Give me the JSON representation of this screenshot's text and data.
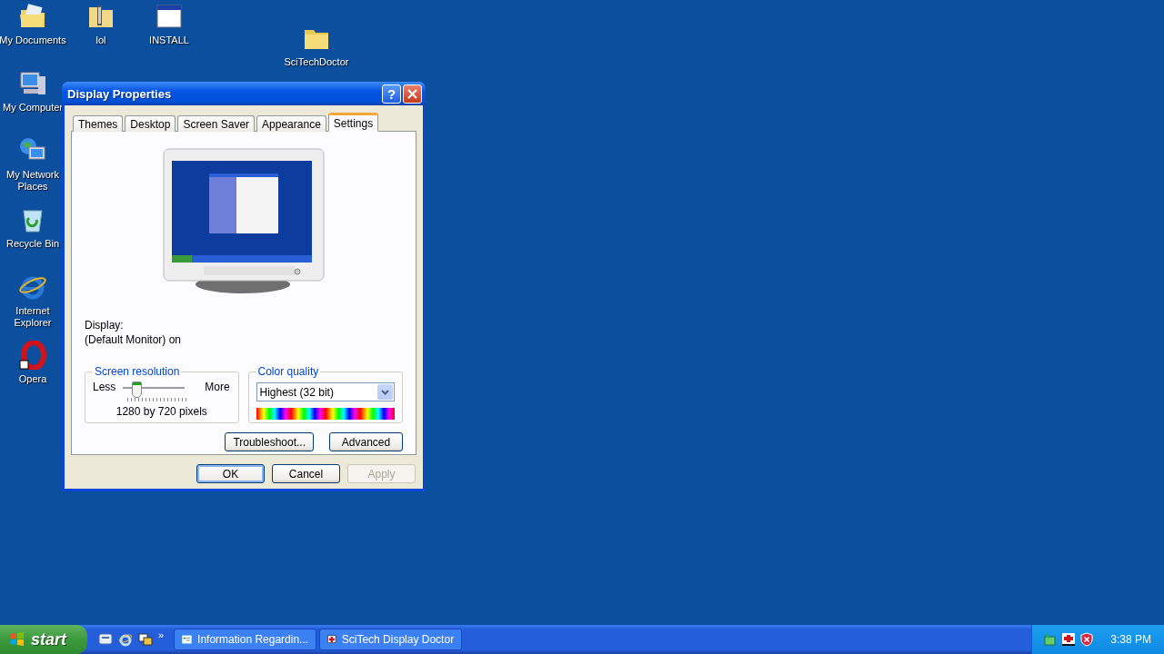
{
  "desktop_icons": [
    {
      "label": "My Documents",
      "kind": "documents"
    },
    {
      "label": "lol",
      "kind": "zip-folder"
    },
    {
      "label": "INSTALL",
      "kind": "window"
    },
    {
      "label": "SciTechDoctor",
      "kind": "folder"
    },
    {
      "label": "My Computer",
      "kind": "computer"
    },
    {
      "label": "My Network Places",
      "kind": "network"
    },
    {
      "label": "Recycle Bin",
      "kind": "recycle"
    },
    {
      "label": "Internet Explorer",
      "kind": "ie"
    },
    {
      "label": "Opera",
      "kind": "opera"
    }
  ],
  "window": {
    "title": "Display Properties",
    "help_button": "?",
    "tabs": [
      {
        "label": "Themes",
        "selected": false
      },
      {
        "label": "Desktop",
        "selected": false
      },
      {
        "label": "Screen Saver",
        "selected": false
      },
      {
        "label": "Appearance",
        "selected": false
      },
      {
        "label": "Settings",
        "selected": true
      }
    ],
    "display_label": "Display:",
    "display_value": "(Default Monitor) on",
    "screen_resolution": {
      "title": "Screen resolution",
      "less": "Less",
      "more": "More",
      "level": 0.22,
      "reading": "1280 by 720 pixels"
    },
    "color_quality": {
      "title": "Color quality",
      "value": "Highest (32 bit)"
    },
    "panel_buttons": [
      "Troubleshoot...",
      "Advanced"
    ],
    "buttons": [
      {
        "label": "OK",
        "default": true,
        "disabled": false
      },
      {
        "label": "Cancel",
        "default": false,
        "disabled": false
      },
      {
        "label": "Apply",
        "default": false,
        "disabled": true
      }
    ]
  },
  "taskbar": {
    "start": "start",
    "quick_launch": [
      {
        "kind": "desktop"
      },
      {
        "kind": "ie"
      },
      {
        "kind": "switch"
      }
    ],
    "more": "»",
    "tasks": [
      {
        "label": "Information Regardin...",
        "kind": "info"
      },
      {
        "label": "SciTech Display Doctor",
        "kind": "scitech"
      }
    ],
    "tray": [
      {
        "kind": "network"
      },
      {
        "kind": "scitech"
      },
      {
        "kind": "shield"
      }
    ],
    "clock": "3:38 PM"
  }
}
